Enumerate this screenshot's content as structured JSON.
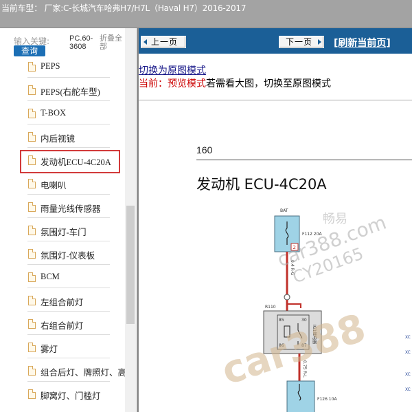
{
  "header": {
    "title": "当前车型： 厂家:C-长城汽车哈弗H7/H7L（Haval H7）2016-2017"
  },
  "sidebar": {
    "search_label": "输入关键:",
    "search_button": "查询",
    "pc_label": "PC.60-3608",
    "collapse_label": "折叠全部",
    "items": [
      {
        "label": "PEPS"
      },
      {
        "label": "PEPS(右舵车型)"
      },
      {
        "label": "T-BOX"
      },
      {
        "label": "内后视镜"
      },
      {
        "label": "发动机ECU-4C20A",
        "selected": true
      },
      {
        "label": "电喇叭"
      },
      {
        "label": "雨量光线传感器"
      },
      {
        "label": "氛围灯-车门"
      },
      {
        "label": "氛围灯-仪表板"
      },
      {
        "label": "BCM"
      },
      {
        "label": "左组合前灯"
      },
      {
        "label": "右组合前灯"
      },
      {
        "label": "雾灯"
      },
      {
        "label": "组合后灯、牌照灯、高"
      },
      {
        "label": "脚窝灯、门槛灯"
      }
    ]
  },
  "nav": {
    "prev_label": "上一页",
    "next_label": "下一页",
    "refresh_label": "[刷新当前页]"
  },
  "mode": {
    "switch_label": "切换为原图模式",
    "current_label": "当前：预览模式",
    "tip": "若需看大图，切换至原图模式"
  },
  "document": {
    "page_number": "160",
    "title": "发动机 ECU-4C20A",
    "diagram_labels": {
      "bat": "BAT",
      "fuse1": "F112 20A",
      "fuse1_num": "2",
      "wire1": "0.4 R-G",
      "relay": "R110",
      "relay_pin85": "85",
      "relay_pin30": "30",
      "relay_pin86": "86",
      "relay_pin87": "87",
      "relay_name": "IG1继电器",
      "wire2": "0.75 R-L",
      "fuse2": "F126 10A",
      "right_code1": "XC",
      "right_code2": "XC",
      "right_code3": "XC",
      "right_code4": "XC"
    },
    "watermarks": [
      "畅易",
      "car388.com",
      "CY20165",
      "car388"
    ]
  },
  "colors": {
    "nav_blue": "#1b5f97",
    "selected_border": "#d23a3a",
    "wire_red": "#c0302a",
    "fuse_fill": "#9fd3e6"
  }
}
